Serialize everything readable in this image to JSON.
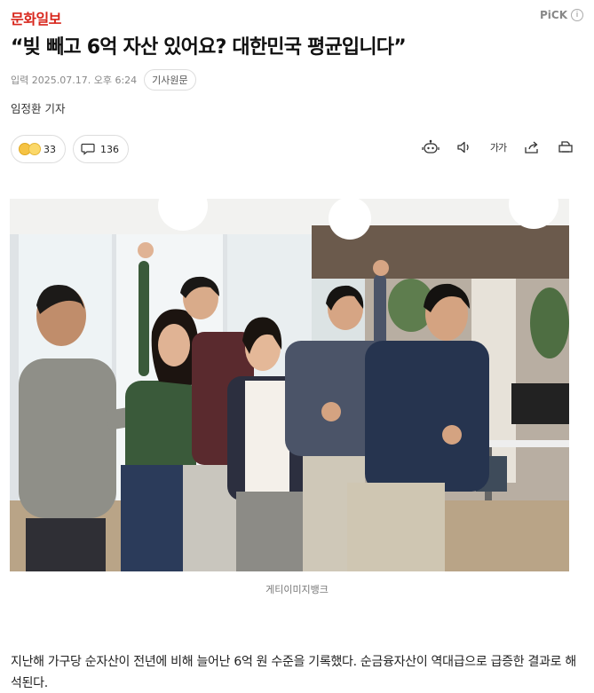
{
  "header": {
    "publisher": "문화일보",
    "pick_label": "PiCK",
    "info_icon": "i"
  },
  "article": {
    "title": "“빚 빼고 6억 자산 있어요? 대한민국 평균입니다”",
    "dateline": "입력 2025.07.17. 오후 6:24",
    "original_button": "기사원문",
    "reporter": "임정환 기자",
    "reactions": {
      "count": "33"
    },
    "comments": {
      "count": "136"
    },
    "text_size_label": "가가",
    "photo_caption": "게티이미지뱅크",
    "body": "지난해 가구당 순자산이 전년에 비해 늘어난 6억 원 수준을 기록했다. 순금융자산이 역대급으로 급증한 결과로 해석된다."
  },
  "icons": {
    "reaction": "emoji-reaction-icon",
    "comment": "speech-bubble-icon",
    "summary": "robot-summary-icon",
    "audio": "speaker-icon",
    "share": "share-icon",
    "print": "print-icon"
  },
  "colors": {
    "brand": "#d8261c",
    "muted": "#888888"
  }
}
